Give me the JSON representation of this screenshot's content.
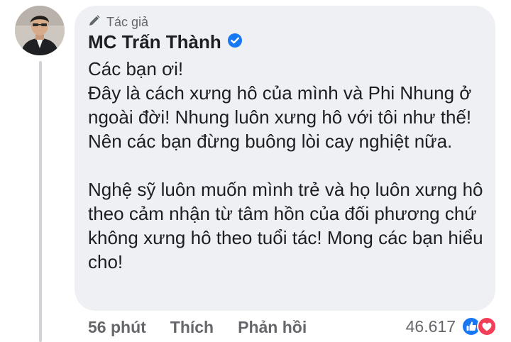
{
  "comment": {
    "author_badge": "Tác giả",
    "author_name": "MC Trấn Thành",
    "text": "Các bạn ơi!\nĐây là cách xưng hô của mình và Phi Nhung ở ngoài đời! Nhung luôn xưng hô với tôi như thế! Nên các bạn đừng buông lòi cay nghiệt nữa.\n\nNghệ sỹ luôn muốn mình trẻ và họ luôn xưng hô theo cảm nhận từ tâm hồn của đối phương chứ không xưng hô theo tuổi tác! Mong các bạn hiểu cho!",
    "time": "56 phút",
    "like_label": "Thích",
    "reply_label": "Phản hồi",
    "reaction_count": "46.617"
  },
  "colors": {
    "bubble": "#eef0f3",
    "facebook_blue": "#1877f2",
    "love_red": "#f33e58",
    "muted_text": "#65676b"
  },
  "icons": {
    "badge": "pencil-icon",
    "verified": "verified-badge-icon",
    "reactions": [
      "like-reaction-icon",
      "love-reaction-icon"
    ]
  }
}
